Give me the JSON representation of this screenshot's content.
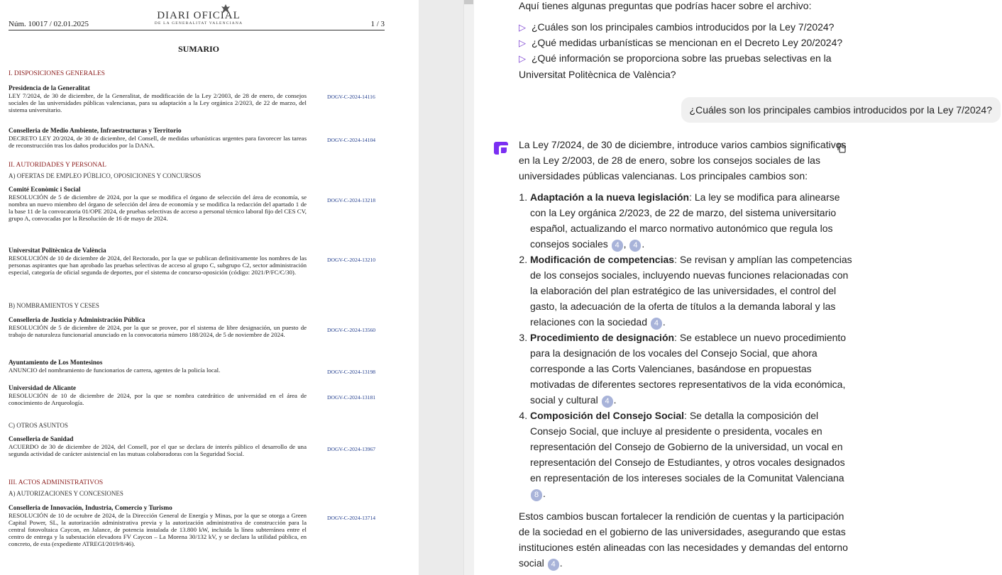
{
  "pdf": {
    "issue": "Núm. 10017 / 02.01.2025",
    "logo_main": "DIARI OFICIAL",
    "logo_sub": "DE LA GENERALITAT VALENCIANA",
    "page": "1 / 3",
    "sumario": "SUMARIO",
    "sections": {
      "s1": "I. DISPOSICIONES GENERALES",
      "s2": "II. AUTORIDADES Y PERSONAL",
      "s2a": "A) OFERTAS DE EMPLEO PÚBLICO, OPOSICIONES Y CONCURSOS",
      "s2b": "B) NOMBRAMIENTOS Y CESES",
      "s2c": "C) OTROS ASUNTOS",
      "s3": "III. ACTOS ADMINISTRATIVOS",
      "s3a": "A) AUTORIZACIONES Y CONCESIONES"
    },
    "entries": [
      {
        "title": "Presidencia de la Generalitat",
        "text": "LEY 7/2024, de 30 de diciembre, de la Generalitat, de modificación de la Ley 2/2003, de 28 de enero, de consejos sociales de las universidades públicas valencianas, para su adaptación a la Ley orgánica 2/2023, de 22 de marzo, del sistema universitario.",
        "code": "DOGV-C-2024-14116"
      },
      {
        "title": "Conselleria de Medio Ambiente, Infraestructuras y Territorio",
        "text": "DECRETO LEY 20/2024, de 30 de diciembre, del Consell, de medidas urbanísticas urgentes para favorecer las tareas de reconstrucción tras los daños producidos por la DANA.",
        "code": "DOGV-C-2024-14104"
      },
      {
        "title": "Comité Econòmic i Social",
        "text": "RESOLUCIÓN de 5 de diciembre de 2024, por la que se modifica el órgano de selección del área de economía, se nombra un nuevo miembro del órgano de selección del área de economía y se modifica la redacción del apartado 1 de la base 11 de la convocatoria 01/OPE 2024, de pruebas selectivas de acceso a personal técnico laboral fijo del CES CV, grupo A, convocadas por la Resolución de 16 de mayo de 2024.",
        "code": "DOGV-C-2024-13218"
      },
      {
        "title": "Universitat Politècnica de València",
        "text": "RESOLUCIÓN de 10 de diciembre de 2024, del Rectorado, por la que se publican definitivamente los nombres de las personas aspirantes que han aprobado las pruebas selectivas de acceso al grupo C, subgrupo C2, sector administración especial, categoría de oficial segunda de deportes, por el sistema de concurso-oposición (código: 2021/P/FC/C/30).",
        "code": "DOGV-C-2024-13210"
      },
      {
        "title": "Conselleria de Justicia y Administración Pública",
        "text": "RESOLUCIÓN de 5 de diciembre de 2024, por la que se provee, por el sistema de libre designación, un puesto de trabajo de naturaleza funcionarial anunciado en la convocatoria número 188/2024, de 5 de noviembre de 2024.",
        "code": "DOGV-C-2024-13560"
      },
      {
        "title": "Ayuntamiento de Los Montesinos",
        "text": "ANUNCIO del nombramiento de funcionarios de carrera, agentes de la policía local.",
        "code": "DOGV-C-2024-13198"
      },
      {
        "title": "Universidad de Alicante",
        "text": "RESOLUCIÓN de 10 de diciembre de 2024, por la que se nombra catedrático de universidad en el área de conocimiento de Arqueología.",
        "code": "DOGV-C-2024-13181"
      },
      {
        "title": "Conselleria de Sanidad",
        "text": "ACUERDO de 30 de diciembre de 2024, del Consell, por el que se declara de interés público el desarrollo de una segunda actividad de carácter asistencial en las mutuas colaboradoras con la Seguridad Social.",
        "code": "DOGV-C-2024-13967"
      },
      {
        "title": "Conselleria de Innovación, Industria, Comercio y Turismo",
        "text": "RESOLUCIÓN de 10 de octubre de 2024, de la Dirección General de Energía y Minas, por la que se otorga a Green Capital Power, SL, la autorización administrativa previa y la autorización administrativa de construcción para la central fotovoltaica Caycon, en Jalance, de potencia instalada de 13.800 kW, incluida la línea subterránea entre el centro de entrega y la subestación elevadora FV Caycon – La Morena 30/132 kV, y se declara la utilidad pública, en concreto, de esta (expediente ATREGI/2019/8/46).",
        "code": "DOGV-C-2024-13714"
      }
    ]
  },
  "chat": {
    "intro": "Aquí tienes algunas preguntas que podrías hacer sobre el archivo:",
    "questions": [
      "¿Cuáles son los principales cambios introducidos por la Ley 7/2024?",
      "¿Qué medidas urbanísticas se mencionan en el Decreto Ley 20/2024?",
      "¿Qué información se proporciona sobre las pruebas selectivas en la Universitat Politècnica de València?"
    ],
    "user_message": "¿Cuáles son los principales cambios introducidos por la Ley 7/2024?",
    "answer": {
      "intro": "La Ley 7/2024, de 30 de diciembre, introduce varios cambios significativos en la Ley 2/2003, de 28 de enero, sobre los consejos sociales de las universidades públicas valencianas. Los principales cambios son:",
      "items": [
        {
          "title": "Adaptación a la nueva legislación",
          "text": ": La ley se modifica para alinearse con la Ley orgánica 2/2023, de 22 de marzo, del sistema universitario español, actualizando el marco normativo autonómico que regula los consejos sociales",
          "cites": [
            "4",
            "4"
          ]
        },
        {
          "title": "Modificación de competencias",
          "text": ": Se revisan y amplían las competencias de los consejos sociales, incluyendo nuevas funciones relacionadas con la elaboración del plan estratégico de las universidades, el control del gasto, la adecuación de la oferta de títulos a la demanda laboral y las relaciones con la sociedad",
          "cites": [
            "4"
          ]
        },
        {
          "title": "Procedimiento de designación",
          "text": ": Se establece un nuevo procedimiento para la designación de los vocales del Consejo Social, que ahora corresponde a las Corts Valencianes, basándose en propuestas motivadas de diferentes sectores representativos de la vida económica, social y cultural",
          "cites": [
            "4"
          ]
        },
        {
          "title": "Composición del Consejo Social",
          "text": ": Se detalla la composición del Consejo Social, que incluye al presidente o presidenta, vocales en representación del Consejo de Gobierno de la universidad, un vocal en representación del Consejo de Estudiantes, y otros vocales designados en representación de los intereses sociales de la Comunitat Valenciana",
          "cites": [
            "8"
          ]
        }
      ],
      "outro": "Estos cambios buscan fortalecer la rendición de cuentas y la participación de la sociedad en el gobierno de las universidades, asegurando que estas instituciones estén alineadas con las necesidades y demandas del entorno social",
      "outro_cites": [
        "4"
      ]
    },
    "icons": {
      "question": "arrow-icon",
      "avatar": "assistant-logo-icon",
      "copy": "copy-icon"
    },
    "colors": {
      "accent": "#7b3fd1",
      "cite": "#a8b3d9",
      "bubble": "#f0f0f0",
      "pdf_section": "#8b1d1d",
      "pdf_code": "#1f3b8c"
    }
  }
}
